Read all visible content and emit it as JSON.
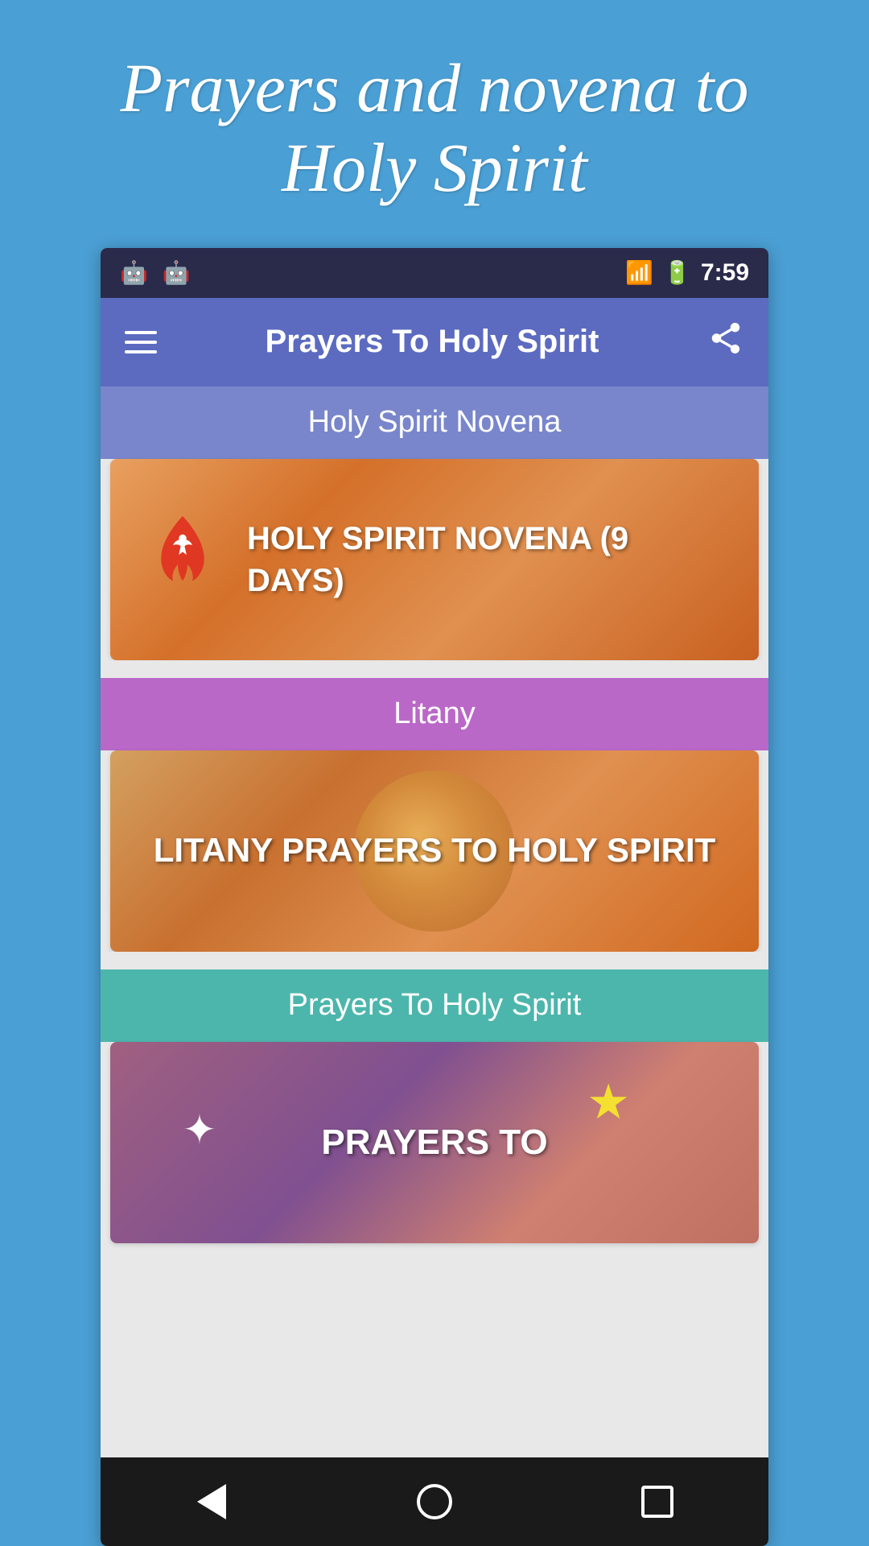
{
  "page": {
    "title": "Prayers and novena to Holy Spirit",
    "background_color": "#4a9fd4"
  },
  "status_bar": {
    "time": "7:59",
    "icons": [
      "signal",
      "battery",
      "charging"
    ]
  },
  "app_bar": {
    "title": "Prayers To Holy Spirit",
    "menu_label": "Menu",
    "share_label": "Share"
  },
  "sections": [
    {
      "id": "novena",
      "header_label": "Holy Spirit Novena",
      "header_color": "#7986cb",
      "card_title": "HOLY SPIRIT NOVENA (9 DAYS)",
      "card_bg": "novena"
    },
    {
      "id": "litany",
      "header_label": "Litany",
      "header_color": "#ba68c8",
      "card_title": "LITANY PRAYERS TO HOLY SPIRIT",
      "card_bg": "litany"
    },
    {
      "id": "prayers",
      "header_label": "Prayers To Holy Spirit",
      "header_color": "#4db6ac",
      "card_title": "PRAYERS TO",
      "card_bg": "prayers"
    }
  ],
  "bottom_nav": {
    "back_label": "Back",
    "home_label": "Home",
    "recent_label": "Recent"
  }
}
